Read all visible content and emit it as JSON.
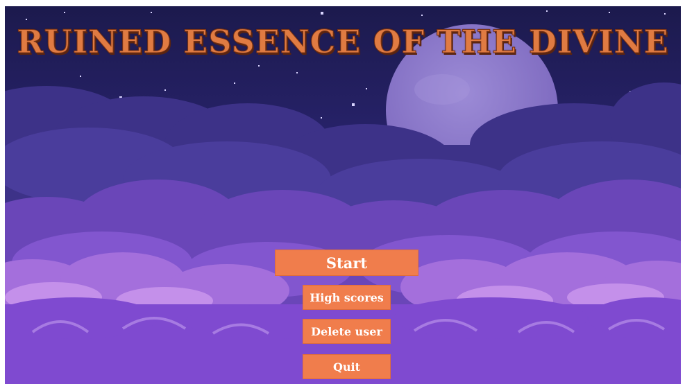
{
  "game": {
    "title": "RUINED ESSENCE OF THE DIVINE"
  },
  "menu": {
    "start_label": "Start",
    "high_scores_label": "High scores",
    "delete_user_label": "Delete user",
    "quit_label": "Quit"
  },
  "colors": {
    "sky": "#1e1b4f",
    "moon": "#8b77c9",
    "cloud_dark": "#4b3b95",
    "cloud_mid": "#7a4fc9",
    "cloud_light": "#b57be4",
    "button": "#f07d4c",
    "title": "#e07b42"
  }
}
